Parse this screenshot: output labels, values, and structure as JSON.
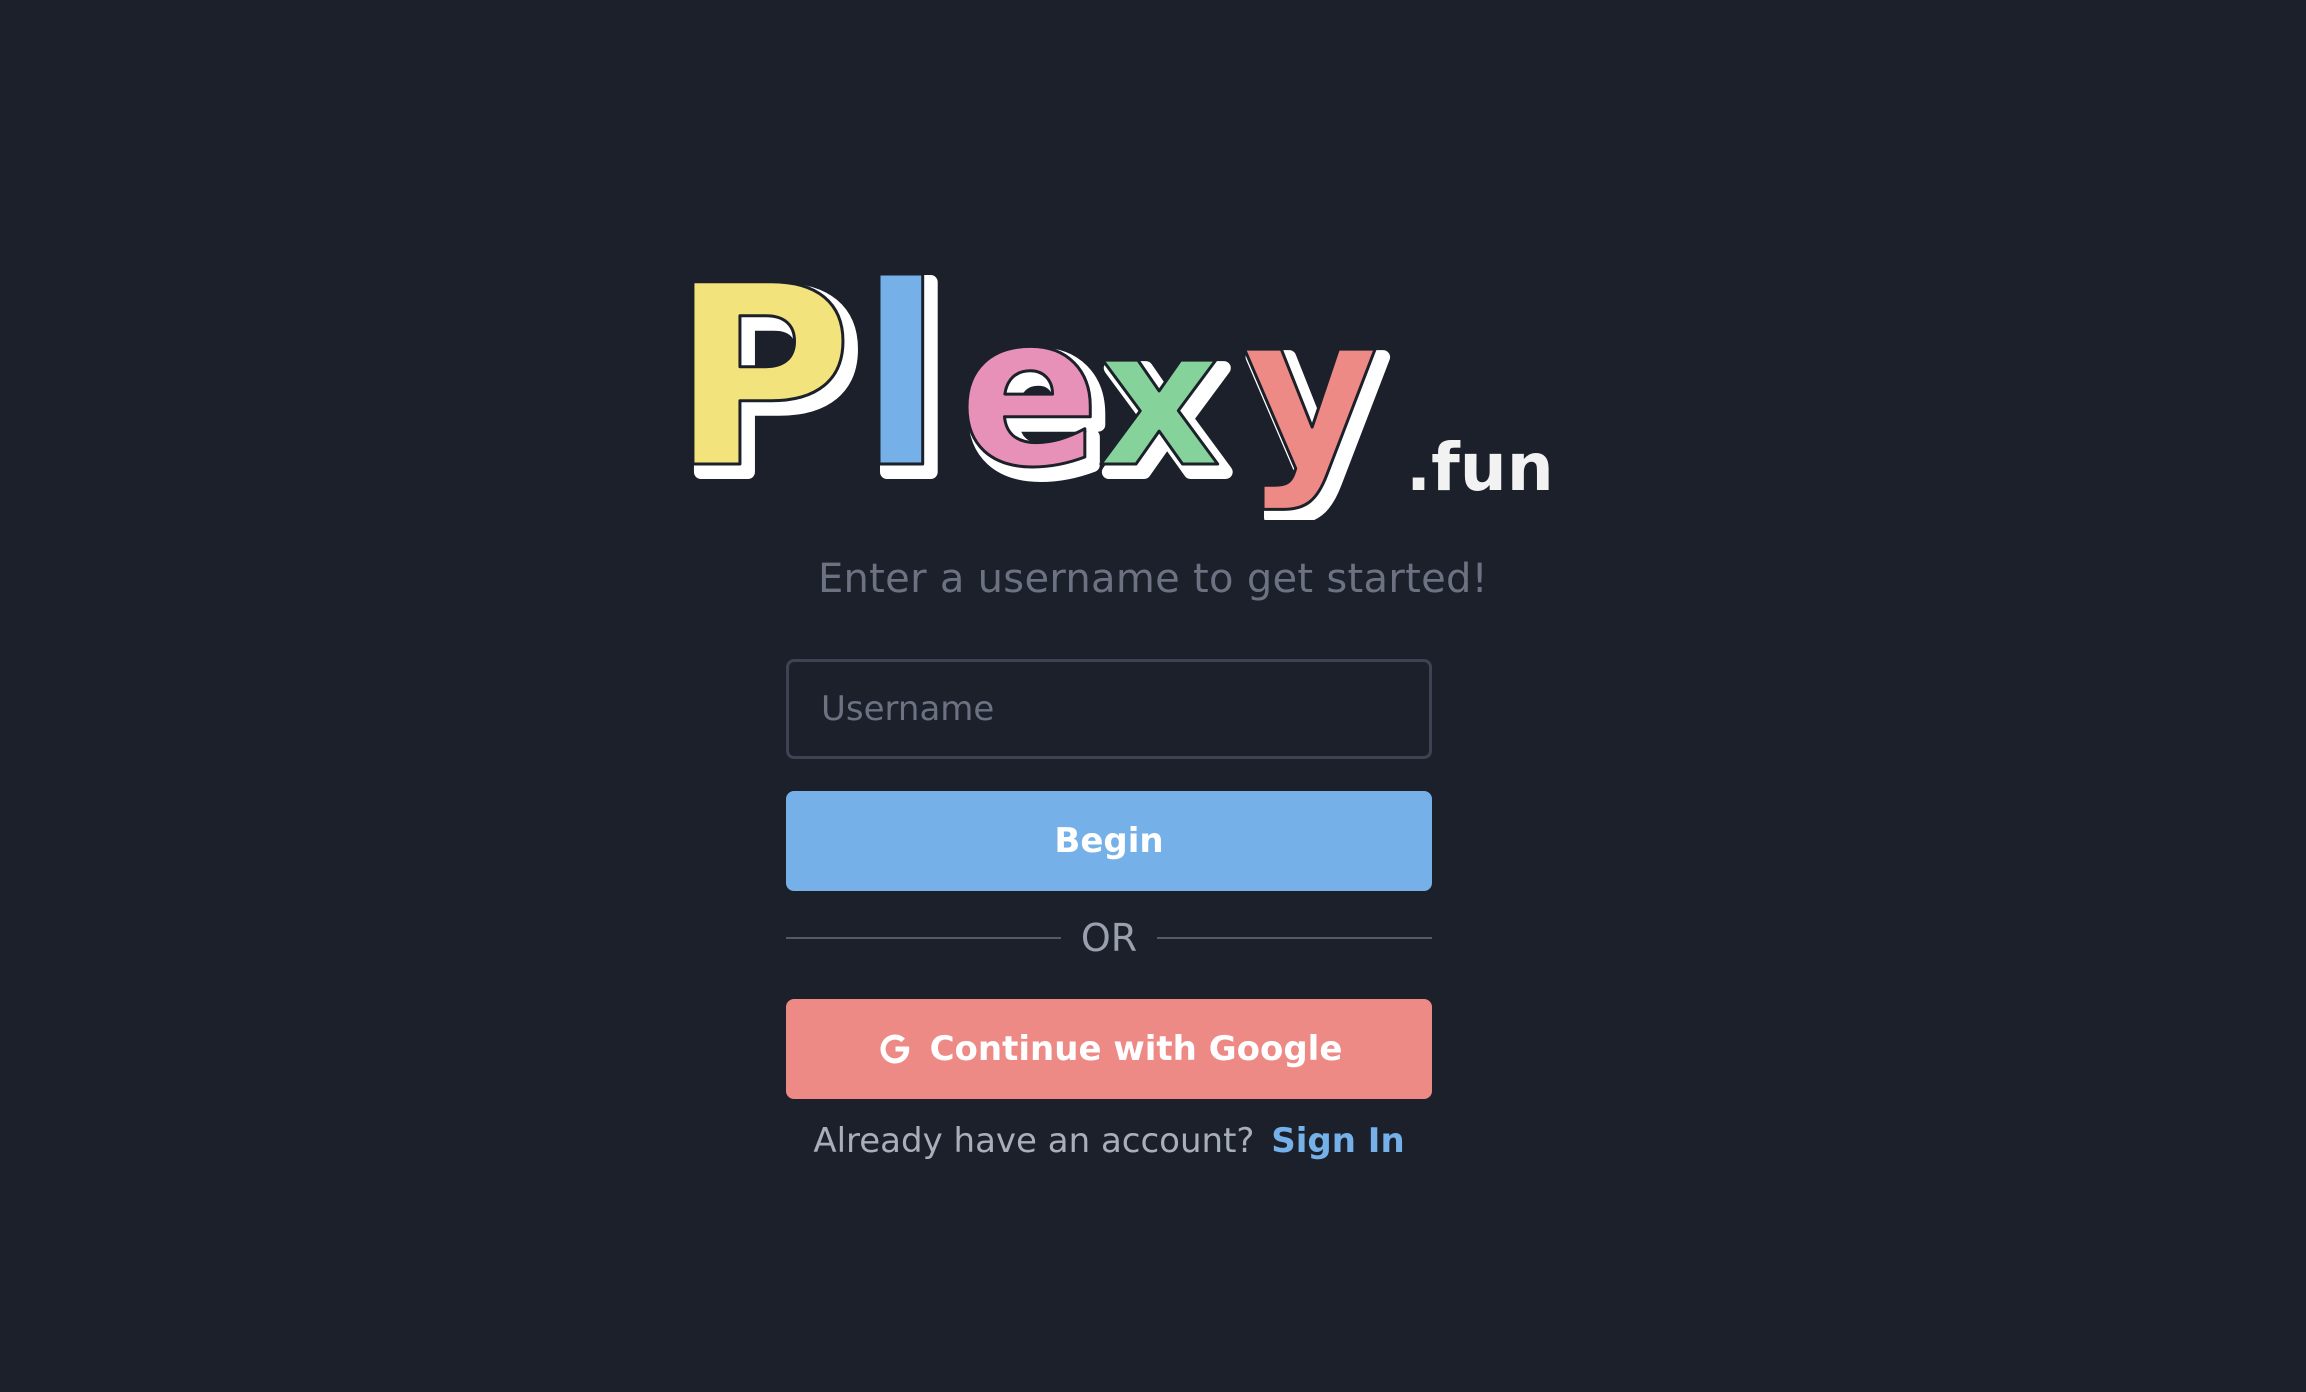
{
  "logo": {
    "letters": [
      "P",
      "l",
      "e",
      "x",
      "y"
    ],
    "suffix": ".fun",
    "letter_colors": [
      "#f3e37c",
      "#75b1e8",
      "#e891b8",
      "#85d39b",
      "#ee8a85"
    ]
  },
  "subtitle": "Enter a username to get started!",
  "username": {
    "placeholder": "Username",
    "value": ""
  },
  "begin_button": "Begin",
  "divider": "OR",
  "google_button": "Continue with Google",
  "signin": {
    "prompt": "Already have an account?",
    "link": "Sign In"
  },
  "colors": {
    "background": "#1c202b",
    "primary": "#75b1e8",
    "google": "#ee8a85"
  },
  "icons": {
    "google": "google-g-icon"
  }
}
